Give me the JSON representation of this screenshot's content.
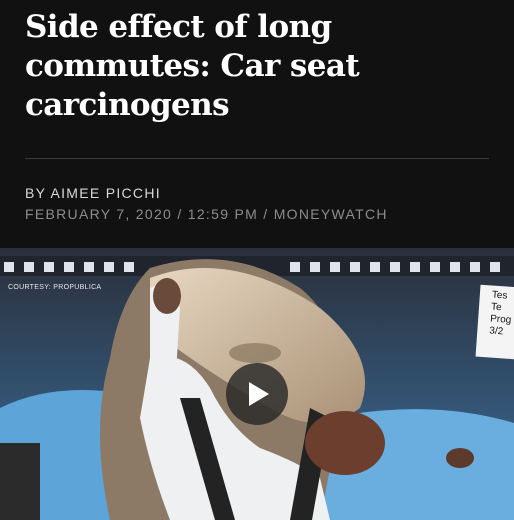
{
  "article": {
    "headline": "Side effect of long commutes: Car seat carcinogens",
    "byline": "BY AIMEE PICCHI",
    "date": "FEBRUARY 7, 2020",
    "time": "12:59 PM",
    "separator": "/",
    "section": "MONEYWATCH"
  },
  "video": {
    "courtesy": "COURTESY: PROPUBLICA",
    "test_card_lines": [
      "Tes",
      "Te",
      "Prog",
      "3/2"
    ],
    "play_icon": "play-icon"
  },
  "colors": {
    "background": "#111111",
    "headline": "#ffffff",
    "byline": "#d8d8d8",
    "dateline": "#8d8d8d"
  }
}
